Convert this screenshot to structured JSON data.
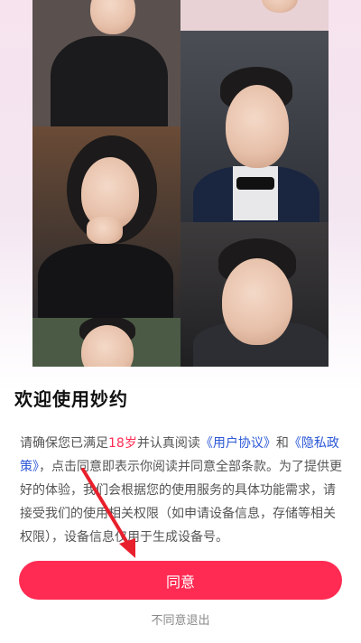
{
  "dialog": {
    "title": "欢迎使用妙约",
    "terms": {
      "p1": "请确保您已满足",
      "age": "18岁",
      "p2": "并认真阅读",
      "user_agreement": "《用户协议》",
      "and": "和",
      "privacy_policy": "《隐私政策》",
      "p3": "，点击同意即表示你阅读并同意全部条款。为了提供更好的体验，我们会根据您的使用服务的具体功能需求，请接受我们的使用相关权限（如申请设备信息，存储等相关权限），设备信息仅用于生成设备号。"
    },
    "agree_label": "同意",
    "exit_label": "不同意退出"
  },
  "colors": {
    "accent": "#ff2b53",
    "link": "#2b57d6",
    "arrow": "#e8202c"
  }
}
